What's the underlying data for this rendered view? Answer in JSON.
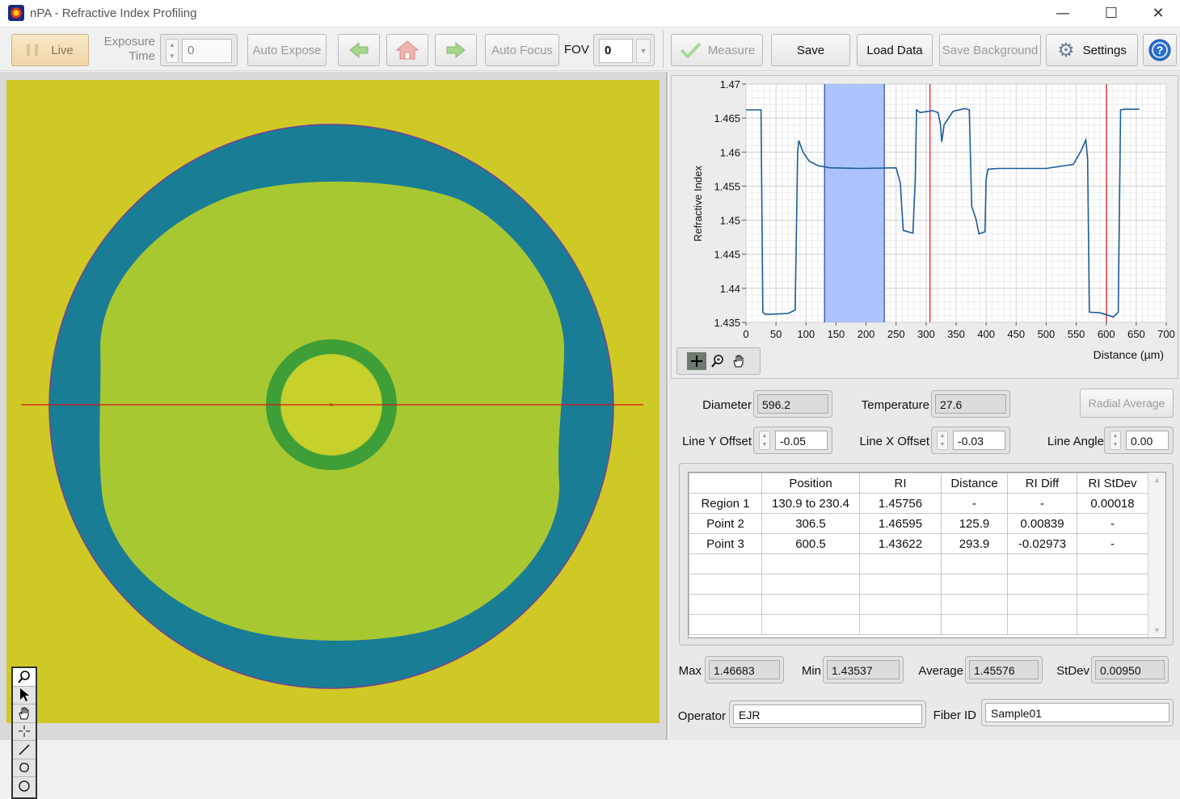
{
  "window": {
    "title": "nPA - Refractive Index Profiling",
    "minimize_glyph": "—",
    "maximize_glyph": "☐",
    "close_glyph": "✕"
  },
  "toolbar": {
    "live_label": "Live",
    "exposure_label_1": "Exposure",
    "exposure_label_2": "Time",
    "exposure_value": "0",
    "auto_expose_label": "Auto Expose",
    "auto_focus_label": "Auto Focus",
    "fov_label": "FOV",
    "fov_value": "0",
    "measure_label": "Measure",
    "save_label": "Save",
    "load_data_label": "Load Data",
    "save_background_label": "Save Background",
    "settings_label": "Settings"
  },
  "tool_palette": [
    "zoom-tool-icon",
    "pointer-tool-icon",
    "pan-tool-icon",
    "crosshair-tool-icon",
    "line-tool-icon",
    "polygon-tool-icon",
    "circle-tool-icon"
  ],
  "colors": {
    "background_yellow": "#cfc926",
    "cladding_blue": "#1a7d96",
    "core_green": "#a8c832",
    "ring_green": "#3e9e38",
    "trace": "#1a5c9e",
    "cursor_red": "#e0101a",
    "region_fill": "#a8c0ff"
  },
  "chart_data": {
    "type": "line",
    "xlabel": "Distance (µm)",
    "ylabel": "Refractive Index",
    "xlim": [
      0,
      700
    ],
    "ylim": [
      1.435,
      1.47
    ],
    "x_ticks": [
      "0",
      "50",
      "100",
      "150",
      "200",
      "250",
      "300",
      "350",
      "400",
      "450",
      "500",
      "550",
      "600",
      "650",
      "700"
    ],
    "y_ticks": [
      "1.435",
      "1.44",
      "1.445",
      "1.45",
      "1.455",
      "1.46",
      "1.465",
      "1.47"
    ],
    "grid": true,
    "region": {
      "x_start": 130.9,
      "x_end": 230.4
    },
    "cursors_x": [
      306.5,
      600.5
    ],
    "series": [
      {
        "x": [
          0,
          25,
          28,
          32,
          40,
          70,
          82,
          86,
          88,
          95,
          105,
          120,
          140,
          190,
          250,
          257,
          262,
          278,
          282,
          284,
          290,
          310,
          320,
          324,
          326,
          330,
          345,
          365,
          372,
          376,
          383,
          388,
          398,
          400,
          403,
          420,
          500,
          545,
          557,
          566,
          569,
          572,
          590,
          612,
          620,
          624,
          630,
          655
        ],
        "y": [
          1.4662,
          1.4662,
          1.4365,
          1.4362,
          1.4362,
          1.4363,
          1.4368,
          1.46,
          1.4617,
          1.46,
          1.4587,
          1.458,
          1.4577,
          1.4576,
          1.4577,
          1.4555,
          1.4485,
          1.4481,
          1.456,
          1.4662,
          1.4658,
          1.4661,
          1.4658,
          1.464,
          1.4615,
          1.464,
          1.466,
          1.4664,
          1.4662,
          1.452,
          1.4502,
          1.448,
          1.4483,
          1.456,
          1.4575,
          1.4576,
          1.4576,
          1.4582,
          1.46,
          1.4618,
          1.459,
          1.4365,
          1.4364,
          1.4358,
          1.4365,
          1.4662,
          1.4663,
          1.4663
        ]
      }
    ]
  },
  "readouts": {
    "diameter_label": "Diameter",
    "diameter_value": "596.2",
    "temperature_label": "Temperature",
    "temperature_value": "27.6",
    "radial_average_label": "Radial Average",
    "line_y_offset_label": "Line Y Offset",
    "line_y_offset_value": "-0.05",
    "line_x_offset_label": "Line X Offset",
    "line_x_offset_value": "-0.03",
    "line_angle_label": "Line Angle",
    "line_angle_value": "0.00"
  },
  "table": {
    "headers": [
      "",
      "Position",
      "RI",
      "Distance",
      "RI Diff",
      "RI StDev"
    ],
    "rows": [
      [
        "Region 1",
        "130.9 to 230.4",
        "1.45756",
        "-",
        "-",
        "0.00018"
      ],
      [
        "Point 2",
        "306.5",
        "1.46595",
        "125.9",
        "0.00839",
        "-"
      ],
      [
        "Point 3",
        "600.5",
        "1.43622",
        "293.9",
        "-0.02973",
        "-"
      ]
    ]
  },
  "stats": {
    "max_label": "Max",
    "max_value": "1.46683",
    "min_label": "Min",
    "min_value": "1.43537",
    "average_label": "Average",
    "average_value": "1.45576",
    "stdev_label": "StDev",
    "stdev_value": "0.00950"
  },
  "meta": {
    "operator_label": "Operator",
    "operator_value": "EJR",
    "fiber_id_label": "Fiber ID",
    "fiber_id_value": "Sample01"
  }
}
